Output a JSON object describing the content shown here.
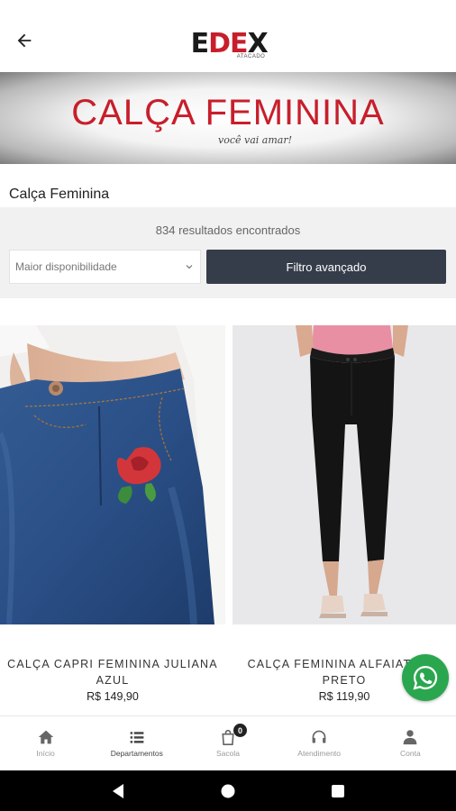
{
  "header": {
    "logo_text_dark1": "E",
    "logo_text_red": "DE",
    "logo_text_dark2": "X",
    "logo_sub": "ATACADO"
  },
  "banner": {
    "title": "CALÇA FEMININA",
    "subtitle": "você vai amar!"
  },
  "page": {
    "title": "Calça Feminina"
  },
  "filters": {
    "results": "834 resultados encontrados",
    "sort_selected": "Maior disponibilidade",
    "advanced_button": "Filtro avançado"
  },
  "products": [
    {
      "name": "CALÇA CAPRI FEMININA JULIANA AZUL",
      "price": "R$ 149,90"
    },
    {
      "name": "CALÇA FEMININA ALFAIATARIA PRETO",
      "price": "R$ 119,90"
    }
  ],
  "bottom_nav": {
    "items": [
      {
        "label": "Início",
        "icon": "home-icon"
      },
      {
        "label": "Departamentos",
        "icon": "list-icon"
      },
      {
        "label": "Sacola",
        "icon": "bag-icon",
        "badge": "0"
      },
      {
        "label": "Atendimento",
        "icon": "headset-icon"
      },
      {
        "label": "Conta",
        "icon": "user-icon"
      }
    ]
  },
  "colors": {
    "brand_red": "#c81e2b",
    "filter_button": "#363d4a",
    "whatsapp_green": "#2aa74e"
  }
}
